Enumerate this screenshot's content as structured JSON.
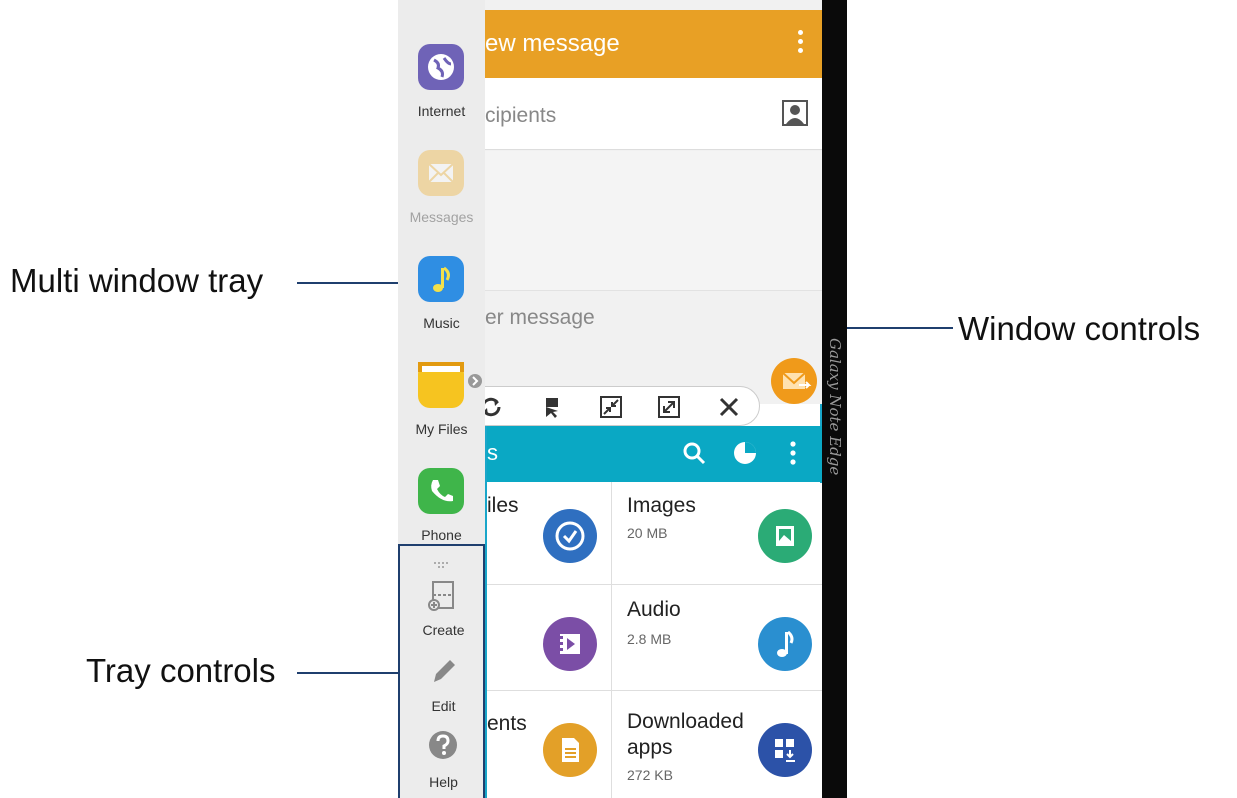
{
  "callouts": {
    "multi_window_tray": "Multi window tray",
    "window_controls": "Window controls",
    "tray_controls": "Tray controls"
  },
  "message_app": {
    "title": "ew message",
    "recipients_placeholder": "cipients",
    "message_placeholder": "er message",
    "accent_color": "#e8a025"
  },
  "tray": {
    "items": [
      {
        "label": "Internet",
        "icon": "globe-icon"
      },
      {
        "label": "Messages",
        "icon": "envelope-icon"
      },
      {
        "label": "Music",
        "icon": "music-note-icon"
      },
      {
        "label": "My Files",
        "icon": "folder-icon"
      },
      {
        "label": "Phone",
        "icon": "phone-icon"
      }
    ],
    "controls": [
      {
        "label": "Create",
        "icon": "create-window-icon"
      },
      {
        "label": "Edit",
        "icon": "pencil-icon"
      },
      {
        "label": "Help",
        "icon": "help-icon"
      }
    ]
  },
  "window_controls": {
    "icons": [
      "switch-windows-icon",
      "drag-drop-icon",
      "minimize-icon",
      "maximize-icon",
      "close-icon"
    ]
  },
  "files_app": {
    "title": "s",
    "accent_color": "#0aa8c4",
    "categories": [
      {
        "label": "iles",
        "size": "",
        "icon": "recent-clock-icon",
        "color": "#2f6fc0"
      },
      {
        "label": "Images",
        "size": "20 MB",
        "icon": "image-icon",
        "color": "#2bab76"
      },
      {
        "label": "",
        "size": "",
        "icon": "video-icon",
        "color": "#7b4ea6"
      },
      {
        "label": "Audio",
        "size": "2.8 MB",
        "icon": "audio-note-icon",
        "color": "#2a8fd0"
      },
      {
        "label": "ents",
        "size": "",
        "icon": "document-icon",
        "color": "#e3a028"
      },
      {
        "label": "Downloaded apps",
        "size": "272 KB",
        "icon": "download-apps-icon",
        "color": "#2c52a8"
      }
    ]
  },
  "edge_text": "Galaxy Note Edge"
}
